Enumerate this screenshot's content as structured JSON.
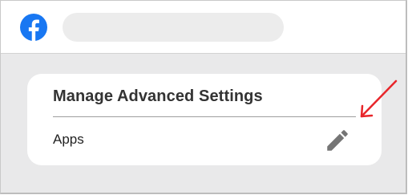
{
  "header": {
    "logo_icon": "facebook-logo-icon",
    "search_placeholder": ""
  },
  "card": {
    "title": "Manage Advanced Settings",
    "rows": [
      {
        "label": "Apps",
        "action_icon": "pencil-edit-icon"
      }
    ]
  },
  "annotation": {
    "arrow_icon": "red-arrow-icon",
    "color": "#e8262b"
  },
  "colors": {
    "facebook_blue": "#1877f2",
    "page_background": "#e9e9ea",
    "edit_icon": "#757575"
  }
}
